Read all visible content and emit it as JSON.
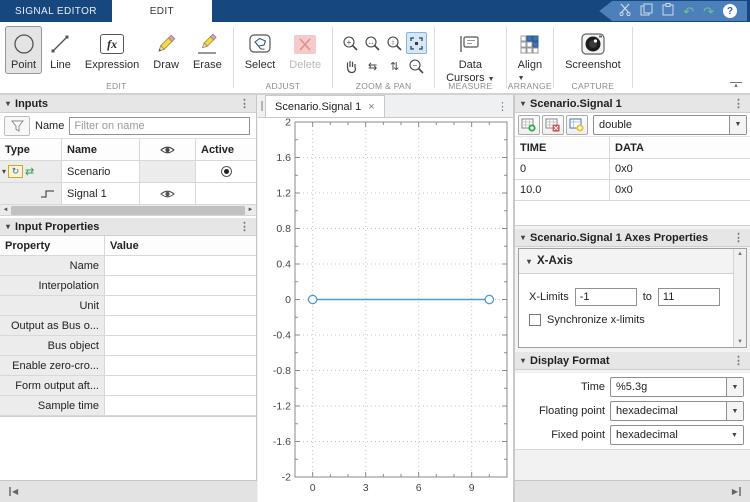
{
  "icons": {
    "menu_dots": "⋮",
    "collapse_triangle": "▾",
    "close": "×",
    "dropdown_arrow": "▼",
    "scroll_left": "◄",
    "scroll_right": "►",
    "scroll_up": "▲",
    "scroll_down": "▼",
    "collapse_left": "◀",
    "collapse_right": "▶",
    "collapse_ribbon": "▲",
    "undo": "↶",
    "redo": "↷",
    "help": "?",
    "rotate_scenario": "↻",
    "swap_arrows": "⇄",
    "pan_x": "⇆",
    "pan_y": "⇅",
    "zoom_in_symbol": "+",
    "zoom_out_symbol": "−",
    "zoom_x_symbol": "↔",
    "zoom_y_symbol": "↕",
    "fx_label": "fx"
  },
  "tabbar": {
    "signal_editor": "SIGNAL EDITOR",
    "edit": "EDIT"
  },
  "ribbon": {
    "edit": {
      "point": "Point",
      "line": "Line",
      "expression": "Expression",
      "draw": "Draw",
      "erase": "Erase",
      "section": "EDIT"
    },
    "adjust": {
      "select": "Select",
      "delete": "Delete",
      "section": "ADJUST"
    },
    "zoom_pan": {
      "section": "ZOOM & PAN"
    },
    "measure": {
      "line1": "Data",
      "line2": "Cursors",
      "section": "MEASURE"
    },
    "arrange": {
      "align": "Align",
      "section": "ARRANGE"
    },
    "capture": {
      "screenshot": "Screenshot",
      "section": "CAPTURE"
    }
  },
  "inputs_panel": {
    "title": "Inputs",
    "filter_label": "Name",
    "filter_placeholder": "Filter on name",
    "col_type": "Type",
    "col_name": "Name",
    "col_active": "Active",
    "rows": [
      {
        "name": "Scenario",
        "active": true
      },
      {
        "name": "Signal 1",
        "visible": true
      }
    ]
  },
  "input_properties": {
    "title": "Input Properties",
    "col_property": "Property",
    "col_value": "Value",
    "rows": [
      "Name",
      "Interpolation",
      "Unit",
      "Output as Bus o...",
      "Bus object",
      "Enable zero-cro...",
      "Form output aft...",
      "Sample time"
    ]
  },
  "plot": {
    "tab_title": "Scenario.Signal 1"
  },
  "chart_data": {
    "type": "line",
    "title": "Scenario.Signal 1",
    "x": [
      0,
      10
    ],
    "series": [
      {
        "name": "Signal 1",
        "y": [
          0,
          0
        ]
      }
    ],
    "xlim": [
      -1,
      11
    ],
    "ylim": [
      -2,
      2
    ],
    "xticks": [
      0,
      3,
      6,
      9
    ],
    "yticks": [
      -2,
      -1.6,
      -1.2,
      -0.8,
      -0.4,
      0,
      0.4,
      0.8,
      1.2,
      1.6,
      2
    ],
    "x_minor_step": 1,
    "y_minor_step": 0.2,
    "grid": true,
    "legend": false,
    "line_color": "#4f9bd5",
    "marker": "circle"
  },
  "signal_panel": {
    "title": "Scenario.Signal 1",
    "datatype": "double",
    "col_time": "TIME",
    "col_data": "DATA",
    "rows": [
      [
        "0",
        "0x0"
      ],
      [
        "10.0",
        "0x0"
      ]
    ]
  },
  "axes_panel": {
    "title": "Scenario.Signal 1 Axes Properties",
    "section_xaxis": "X-Axis",
    "xlimits_label": "X-Limits",
    "xmin": "-1",
    "to_label": "to",
    "xmax": "11",
    "sync_label": "Synchronize x-limits",
    "sync_checked": false
  },
  "display_format": {
    "title": "Display Format",
    "time_label": "Time",
    "time_value": "%5.3g",
    "floating_label": "Floating point",
    "floating_value": "hexadecimal",
    "fixed_label": "Fixed point",
    "fixed_value": "hexadecimal"
  },
  "colors": {
    "toolstrip_blue": "#16477e",
    "quick_access_blue": "#4c80bb",
    "line_blue": "#4f9bd5"
  }
}
